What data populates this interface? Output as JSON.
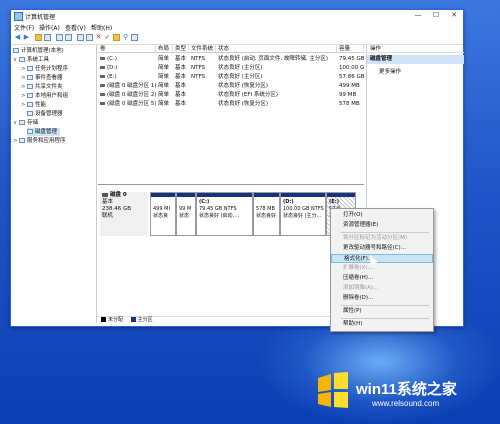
{
  "app": {
    "title": "计算机管理"
  },
  "window_buttons": {
    "minimize": "—",
    "maximize": "☐",
    "close": "✕"
  },
  "menu": [
    "文件(F)",
    "操作(A)",
    "查看(V)",
    "帮助(H)"
  ],
  "tree": [
    {
      "label": "计算机管理(本地)",
      "exp": ""
    },
    {
      "label": "系统工具",
      "exp": "∨"
    },
    {
      "label": "任务计划程序",
      "exp": ">"
    },
    {
      "label": "事件查看器",
      "exp": ">"
    },
    {
      "label": "共享文件夹",
      "exp": ">"
    },
    {
      "label": "本地用户和组",
      "exp": ">"
    },
    {
      "label": "性能",
      "exp": ">"
    },
    {
      "label": "设备管理器",
      "exp": ""
    },
    {
      "label": "存储",
      "exp": "∨"
    },
    {
      "label": "磁盘管理",
      "exp": ""
    },
    {
      "label": "服务和应用程序",
      "exp": ">"
    }
  ],
  "volume_table": {
    "headers": [
      "卷",
      "布局",
      "类型",
      "文件系统",
      "状态",
      "容量"
    ],
    "rows": [
      [
        "(C:)",
        "简单",
        "基本",
        "NTFS",
        "状态良好 (启动, 页面文件, 故障转储, 主分区)",
        "79.45 GB"
      ],
      [
        "(D:)",
        "简单",
        "基本",
        "NTFS",
        "状态良好 (主分区)",
        "100.00 GB"
      ],
      [
        "(E:)",
        "简单",
        "基本",
        "NTFS",
        "状态良好 (主分区)",
        "57.86 GB"
      ],
      [
        "(磁盘 0 磁盘分区 1)",
        "简单",
        "基本",
        "",
        "状态良好 (恢复分区)",
        "499 MB"
      ],
      [
        "(磁盘 0 磁盘分区 2)",
        "简单",
        "基本",
        "",
        "状态良好 (EFI 系统分区)",
        "99 MB"
      ],
      [
        "(磁盘 0 磁盘分区 5)",
        "简单",
        "基本",
        "",
        "状态良好 (恢复分区)",
        "578 MB"
      ]
    ]
  },
  "actions": {
    "header": "操作",
    "selected": "磁盘管理",
    "more": "更多操作"
  },
  "disk": {
    "label": "磁盘 0",
    "type": "基本",
    "size": "238.46 GB",
    "status": "联机",
    "partitions": [
      {
        "name": "",
        "size": "499 MI",
        "status": "状态良"
      },
      {
        "name": "",
        "size": "99 M",
        "status": "状态"
      },
      {
        "name": "(C:)",
        "size": "79.45 GB NTFS",
        "status": "状态良好 (启动,…"
      },
      {
        "name": "",
        "size": "578 MB",
        "status": "状态良好"
      },
      {
        "name": "(D:)",
        "size": "100.00 GB NTFS",
        "status": "状态良好 (主分…"
      },
      {
        "name": "(E:)",
        "size": "57.8",
        "status": "状态"
      }
    ]
  },
  "legend": [
    {
      "label": "未分配",
      "color": "#000000"
    },
    {
      "label": "主分区",
      "color": "#17337e"
    }
  ],
  "context_menu": [
    {
      "label": "打开(O)",
      "enabled": true
    },
    {
      "label": "资源管理器(E)",
      "enabled": true
    },
    {
      "label": "将分区标记为活动分区(M)",
      "enabled": false
    },
    {
      "label": "更改驱动器号和路径(C)...",
      "enabled": true
    },
    {
      "label": "格式化(F)...",
      "enabled": true,
      "highlighted": true
    },
    {
      "label": "扩展卷(X)...",
      "enabled": false
    },
    {
      "label": "压缩卷(H)...",
      "enabled": true
    },
    {
      "label": "添加镜像(A)...",
      "enabled": false
    },
    {
      "label": "删除卷(D)...",
      "enabled": true
    },
    {
      "label": "属性(P)",
      "enabled": true
    },
    {
      "label": "帮助(H)",
      "enabled": true
    }
  ],
  "watermark": {
    "brand": "win11系统之家",
    "url": "www.relsound.com"
  }
}
